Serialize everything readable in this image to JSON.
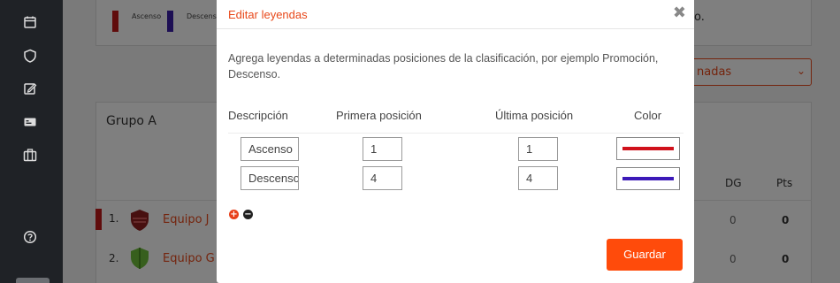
{
  "background": {
    "legend": [
      {
        "label": "Ascenso",
        "color": "#c01818"
      },
      {
        "label": "Descenso",
        "color": "#3a1fa8"
      }
    ],
    "tail_text": "o.",
    "select_value": "nadas",
    "group_title": "Grupo A",
    "columns": [
      "DG",
      "Pts"
    ],
    "rows": [
      {
        "rank": "1.",
        "team": "Equipo J",
        "dg": "0",
        "pts": "0",
        "bar_color": "#c01818"
      },
      {
        "rank": "2.",
        "team": "Equipo G",
        "dg": "0",
        "pts": "0",
        "bar_color": ""
      }
    ]
  },
  "sidebar_icons": [
    "calendar-icon",
    "shield-icon",
    "edit-icon",
    "card-icon",
    "briefcase-icon",
    "help-icon"
  ],
  "modal": {
    "title": "Editar leyendas",
    "close_label": "✖",
    "intro": "Agrega leyendas a determinadas posiciones de la clasificación, por ejemplo Promoción, Descenso.",
    "headers": {
      "description": "Descripción",
      "first": "Primera posición",
      "last": "Última posición",
      "color": "Color"
    },
    "rows": [
      {
        "description": "Ascenso",
        "first": "1",
        "last": "1",
        "color": "#d0111b"
      },
      {
        "description": "Descenso",
        "first": "4",
        "last": "4",
        "color": "#3c19b8"
      }
    ],
    "add_label": "+",
    "remove_label": "−",
    "save_label": "Guardar"
  }
}
